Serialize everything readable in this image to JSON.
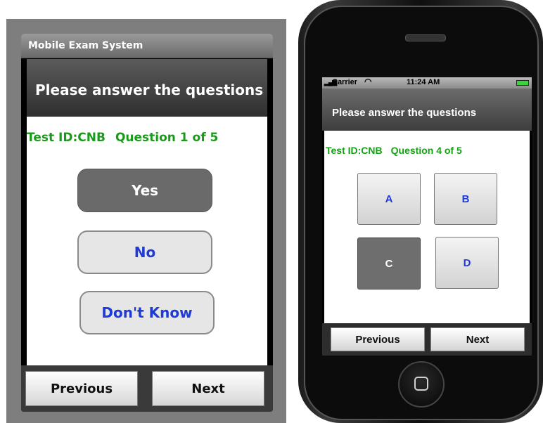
{
  "android": {
    "title_bar": "Mobile Exam System",
    "header": "Please answer the questions",
    "test_id": "Test ID:CNB",
    "question_progress": "Question 1 of 5",
    "answers": [
      {
        "label": "Yes",
        "selected": true
      },
      {
        "label": "No",
        "selected": false
      },
      {
        "label": "Don't Know",
        "selected": false
      }
    ],
    "nav": {
      "previous": "Previous",
      "next": "Next"
    }
  },
  "iphone": {
    "status_bar": {
      "carrier": "Carrier",
      "time": "11:24 AM"
    },
    "header": "Please answer the questions",
    "test_id": "Test ID:CNB",
    "question_progress": "Question 4 of 5",
    "answers": [
      {
        "label": "A",
        "selected": false
      },
      {
        "label": "B",
        "selected": false
      },
      {
        "label": "C",
        "selected": true
      },
      {
        "label": "D",
        "selected": false
      }
    ],
    "nav": {
      "previous": "Previous",
      "next": "Next"
    }
  },
  "colors": {
    "status_green": "#1a9a1a",
    "answer_blue": "#1f3bd6",
    "selected_gray": "#6a6a6a"
  }
}
